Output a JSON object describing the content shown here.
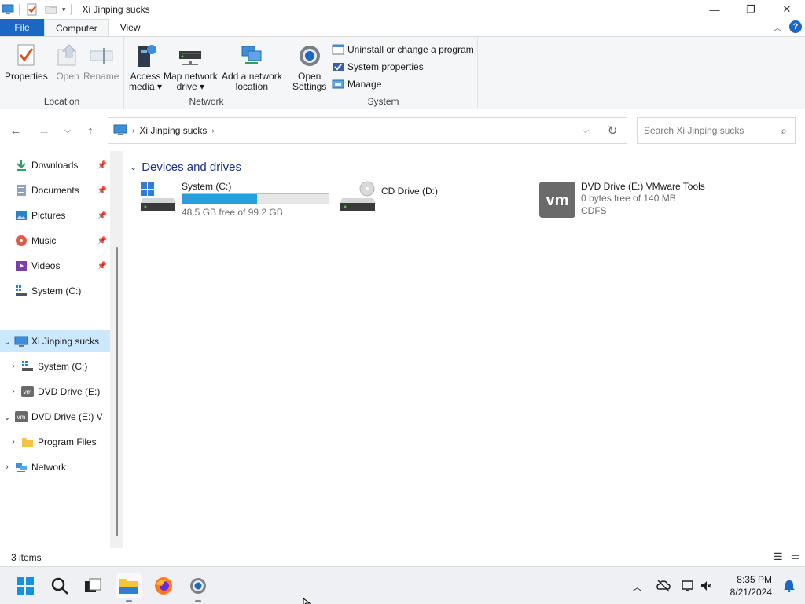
{
  "window": {
    "title": "Xi Jinping sucks",
    "controls": {
      "minimize": "—",
      "maximize": "❐",
      "close": "✕"
    }
  },
  "ribbon": {
    "tabs": [
      {
        "label": "File"
      },
      {
        "label": "Computer"
      },
      {
        "label": "View"
      }
    ],
    "location_group": {
      "label": "Location",
      "properties": "Properties",
      "open": "Open",
      "rename": "Rename"
    },
    "network_group": {
      "label": "Network",
      "access_media_1": "Access",
      "access_media_2": "media ▾",
      "map_drive_1": "Map network",
      "map_drive_2": "drive ▾",
      "add_location_1": "Add a network",
      "add_location_2": "location"
    },
    "system_group": {
      "label": "System",
      "open_settings_1": "Open",
      "open_settings_2": "Settings",
      "uninstall": "Uninstall or change a program",
      "system_properties": "System properties",
      "manage": "Manage"
    }
  },
  "address": {
    "crumb": "Xi Jinping sucks",
    "search_placeholder": "Search Xi Jinping sucks"
  },
  "nav_pane": {
    "items": [
      {
        "label": "Downloads",
        "pinned": true
      },
      {
        "label": "Documents",
        "pinned": true
      },
      {
        "label": "Pictures",
        "pinned": true
      },
      {
        "label": "Music",
        "pinned": true
      },
      {
        "label": "Videos",
        "pinned": true
      },
      {
        "label": "System (C:)",
        "pinned": false
      },
      {
        "label": "Xi Jinping sucks",
        "selected": true
      },
      {
        "label": "System (C:)"
      },
      {
        "label": "DVD Drive (E:)"
      },
      {
        "label": "DVD Drive (E:) V"
      },
      {
        "label": "Program Files"
      },
      {
        "label": "Network"
      }
    ]
  },
  "content": {
    "section_title": "Devices and drives",
    "drives": [
      {
        "name": "System (C:)",
        "free_text": "48.5 GB free of 99.2 GB",
        "used_fraction": 0.511
      },
      {
        "name": "CD Drive (D:)"
      },
      {
        "name": "DVD Drive (E:) VMware Tools",
        "free_text": "0 bytes free of 140 MB",
        "fs": "CDFS"
      }
    ]
  },
  "status": {
    "item_count": "3 items"
  },
  "taskbar": {
    "time": "8:35 PM",
    "date": "8/21/2024"
  },
  "colors": {
    "accent": "#1a67c4",
    "selection": "#cce8ff",
    "progress": "#26a0da",
    "section_heading": "#1e3287"
  }
}
